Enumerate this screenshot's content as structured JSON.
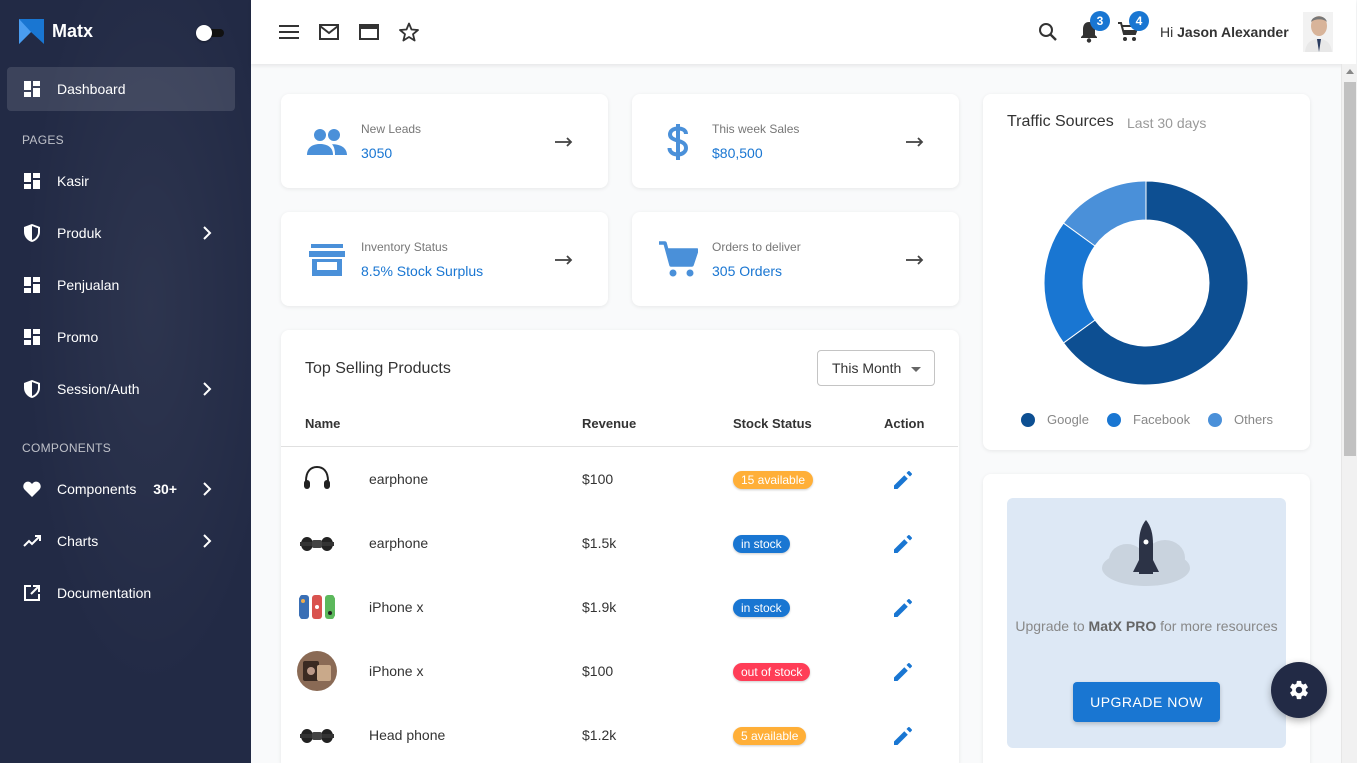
{
  "brand": {
    "name": "Matx"
  },
  "sidebar": {
    "dashboard": "Dashboard",
    "section_pages": "PAGES",
    "kasir": "Kasir",
    "produk": "Produk",
    "penjualan": "Penjualan",
    "promo": "Promo",
    "session_auth": "Session/Auth",
    "section_components": "COMPONENTS",
    "components": "Components",
    "components_badge": "30+",
    "charts": "Charts",
    "documentation": "Documentation"
  },
  "topbar": {
    "notification_count": "3",
    "cart_count": "4",
    "greeting": "Hi",
    "user_name": "Jason Alexander"
  },
  "stats": [
    {
      "label": "New Leads",
      "value": "3050",
      "icon": "people-icon"
    },
    {
      "label": "This week Sales",
      "value": "$80,500",
      "icon": "dollar-icon"
    },
    {
      "label": "Inventory Status",
      "value": "8.5% Stock Surplus",
      "icon": "store-icon"
    },
    {
      "label": "Orders to deliver",
      "value": "305 Orders",
      "icon": "cart-icon"
    }
  ],
  "top_selling": {
    "title": "Top Selling Products",
    "period": "This Month",
    "columns": {
      "name": "Name",
      "revenue": "Revenue",
      "stock": "Stock Status",
      "action": "Action"
    },
    "rows": [
      {
        "name": "earphone",
        "revenue": "$100",
        "status": "15 available",
        "status_color": "#ffaf38"
      },
      {
        "name": "earphone",
        "revenue": "$1.5k",
        "status": "in stock",
        "status_color": "#1976d2"
      },
      {
        "name": "iPhone x",
        "revenue": "$1.9k",
        "status": "in stock",
        "status_color": "#1976d2"
      },
      {
        "name": "iPhone x",
        "revenue": "$100",
        "status": "out of stock",
        "status_color": "#ff3d57"
      },
      {
        "name": "Head phone",
        "revenue": "$1.2k",
        "status": "5 available",
        "status_color": "#ffaf38"
      }
    ]
  },
  "traffic": {
    "title": "Traffic Sources",
    "subtitle": "Last 30 days",
    "legend": [
      {
        "name": "Google",
        "color": "#0d4f92"
      },
      {
        "name": "Facebook",
        "color": "#1976d2"
      },
      {
        "name": "Others",
        "color": "#4a90d9"
      }
    ]
  },
  "chart_data": {
    "type": "pie",
    "title": "",
    "categories": [
      "Google",
      "Facebook",
      "Others"
    ],
    "values": [
      65,
      20,
      15
    ],
    "colors": [
      "#0d4f92",
      "#1976d2",
      "#4a90d9"
    ]
  },
  "upgrade": {
    "prefix": "Upgrade to ",
    "product": "MatX PRO",
    "suffix": " for more resources",
    "button": "UPGRADE NOW"
  }
}
